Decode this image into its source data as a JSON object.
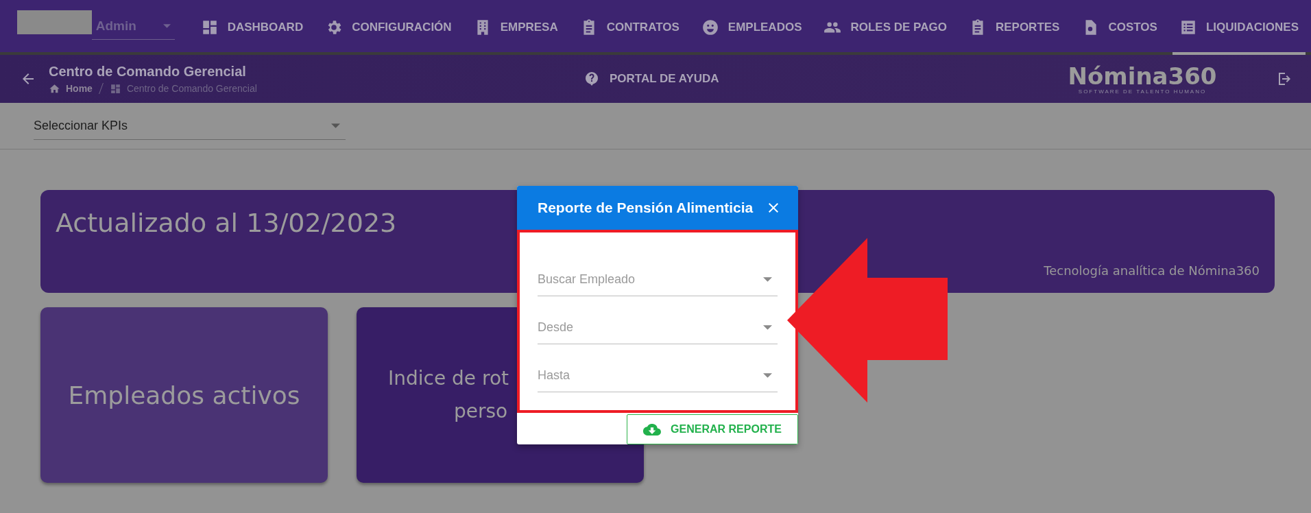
{
  "nav": {
    "account": "Admin",
    "tabs": [
      {
        "label": "DASHBOARD",
        "selected": false
      },
      {
        "label": "CONFIGURACIÓN",
        "selected": false
      },
      {
        "label": "EMPRESA",
        "selected": false
      },
      {
        "label": "CONTRATOS",
        "selected": false
      },
      {
        "label": "EMPLEADOS",
        "selected": false
      },
      {
        "label": "ROLES DE PAGO",
        "selected": false
      },
      {
        "label": "REPORTES",
        "selected": false
      },
      {
        "label": "COSTOS",
        "selected": false
      },
      {
        "label": "LIQUIDACIONES",
        "selected": true
      }
    ]
  },
  "header": {
    "title": "Centro de Comando Gerencial",
    "breadcrumbs": [
      "Home",
      "Centro de Comando Gerencial"
    ],
    "help": "PORTAL DE AYUDA",
    "logo": {
      "name": "Nómina360",
      "tagline": "SOFTWARE DE TALENTO HUMANO"
    }
  },
  "kpi_select": {
    "placeholder": "Seleccionar KPIs"
  },
  "banner": {
    "title": "Actualizado al 13/02/2023",
    "caption": "Tecnología analítica de Nómina360"
  },
  "cards": [
    {
      "lines": [
        "Empleados activos"
      ]
    },
    {
      "lines": [
        "Indice de rot",
        "perso"
      ]
    }
  ],
  "dialog": {
    "title": "Reporte de Pensión Alimenticia",
    "fields": [
      {
        "kind": "select",
        "placeholder": "Buscar Empleado"
      },
      {
        "kind": "select",
        "placeholder": "Desde"
      },
      {
        "kind": "select",
        "placeholder": "Hasta"
      }
    ],
    "button": "GENERAR REPORTE"
  }
}
